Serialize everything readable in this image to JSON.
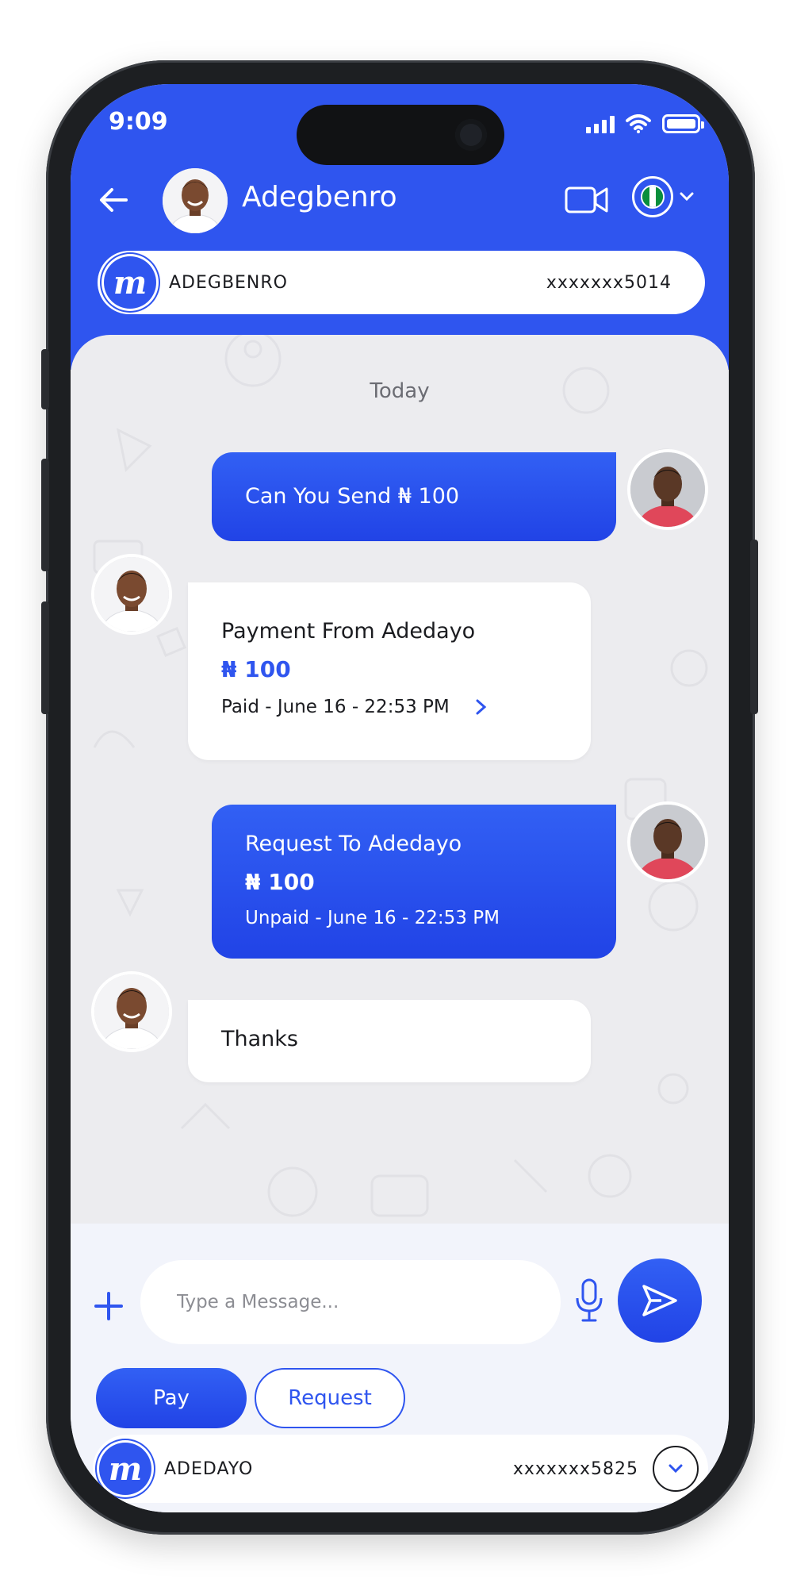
{
  "status": {
    "time": "9:09"
  },
  "header": {
    "contact_name": "Adegbenro",
    "account": {
      "name": "ADEGBENRO",
      "number": "xxxxxxx5014"
    }
  },
  "chat": {
    "date_label": "Today",
    "messages": [
      {
        "from": "me",
        "text": "Can You Send ₦ 100"
      },
      {
        "from": "contact",
        "title": "Payment From Adedayo",
        "amount": "₦ 100",
        "status": "Paid - June 16 - 22:53 PM"
      },
      {
        "from": "me",
        "title": "Request To Adedayo",
        "amount": "₦ 100",
        "status": "Unpaid - June 16 - 22:53 PM"
      },
      {
        "from": "contact",
        "text": "Thanks"
      }
    ]
  },
  "composer": {
    "placeholder": "Type a Message...",
    "pay_label": "Pay",
    "request_label": "Request"
  },
  "sender_account": {
    "name": "ADEDAYO",
    "number": "xxxxxxx5825"
  },
  "colors": {
    "accent": "#2f55ef",
    "chat_bg": "#ececef",
    "composer_bg": "#f2f4fb",
    "flag_green": "#0a8f3c"
  }
}
